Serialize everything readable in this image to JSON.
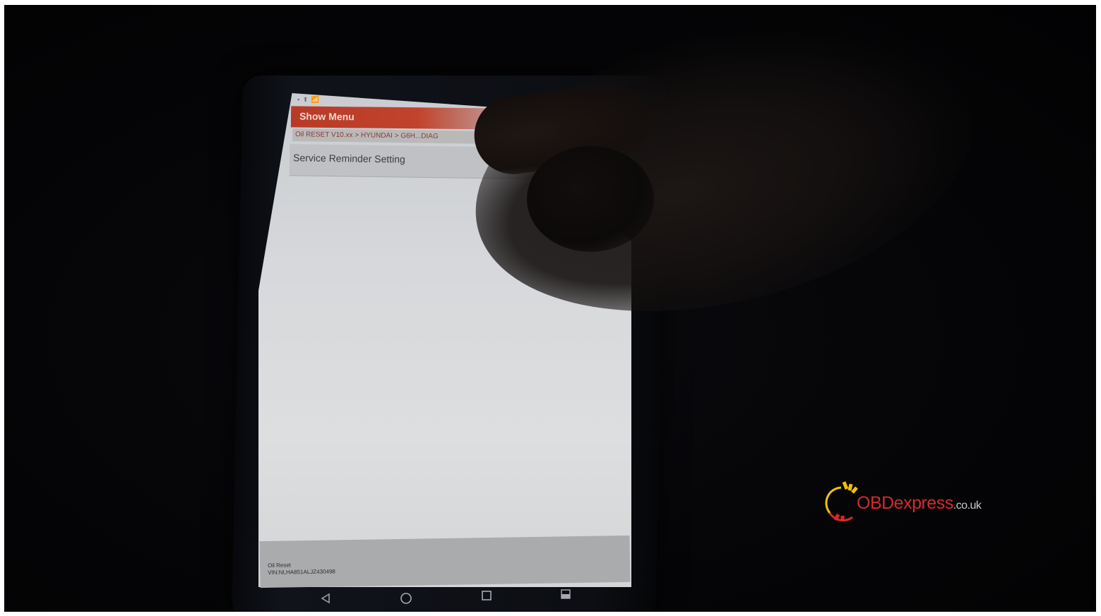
{
  "app": {
    "title": "Show Menu",
    "status_bar_text": "▪ ⬆ 📶",
    "breadcrumb": "Oil RESET V10.xx > HYUNDAI > G6H...DIAG",
    "menu_items": [
      {
        "label": "Service Reminder Setting"
      }
    ],
    "footer": {
      "line1": "Oil Reset",
      "line2": "VIN:NLHA851ALJZ430498"
    },
    "nav": {
      "back_icon": "back-triangle-icon",
      "home_icon": "home-circle-icon",
      "recents_icon": "recents-square-icon",
      "screenshot_icon": "screenshot-icon"
    }
  },
  "watermark": {
    "brand": "OBDexpress",
    "suffix": ".co.uk"
  },
  "colors": {
    "app_bar": "#c2432c",
    "screen": "#d6d8db",
    "logo_red": "#d52a2a",
    "logo_yellow": "#f2c200"
  }
}
